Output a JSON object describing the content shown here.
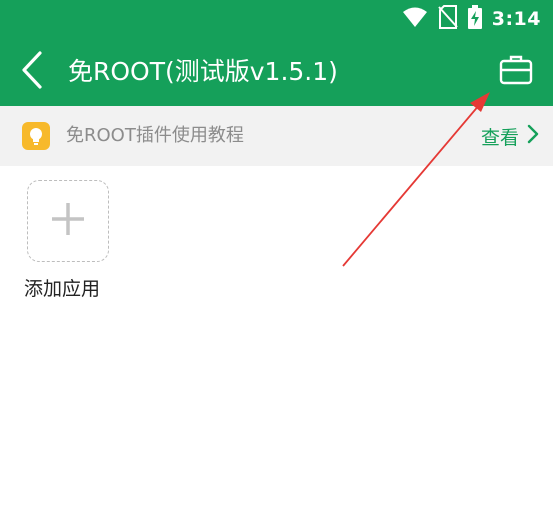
{
  "status_bar": {
    "time": "3:14",
    "icons": [
      "wifi-icon",
      "no-sim-icon",
      "battery-charging-icon"
    ]
  },
  "app_bar": {
    "title": "免ROOT(测试版v1.5.1)",
    "back_icon": "chevron-left-icon",
    "action_icon": "briefcase-icon"
  },
  "tip_banner": {
    "icon": "lightbulb-icon",
    "text": "免ROOT插件使用教程",
    "link_label": "查看",
    "link_icon": "chevron-right-icon"
  },
  "apps": {
    "add_label": "添加应用",
    "add_icon": "plus-icon"
  },
  "colors": {
    "primary": "#15a05a",
    "banner_bg": "#f2f2f2",
    "tip_icon_bg": "#f7b92b",
    "annotation": "#e53935"
  }
}
